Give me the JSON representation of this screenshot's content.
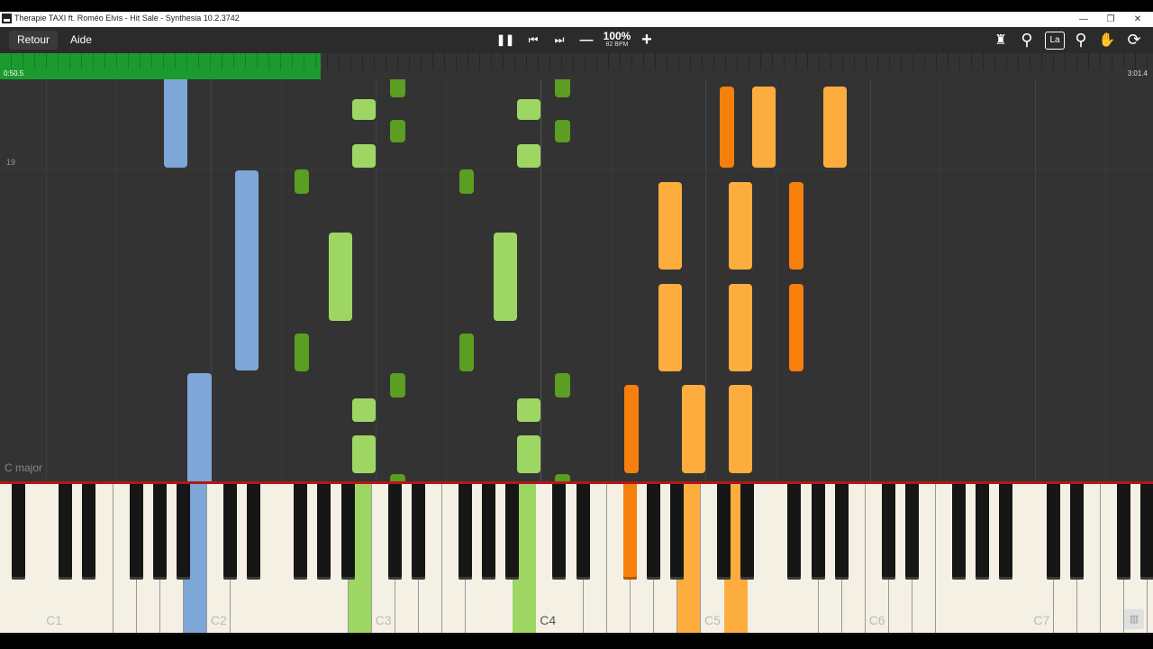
{
  "window": {
    "title": "Therapie TAXI ft. Roméo Elvis - Hit Sale - Synthesia 10.2.3742",
    "minimize": "—",
    "restore": "❐",
    "close": "✕"
  },
  "toolbar": {
    "back_label": "Retour",
    "help_label": "Aide",
    "pause_icon": "❚❚",
    "prev_icon": "⏮",
    "next_icon": "⏭",
    "minus_icon": "—",
    "plus_icon": "+",
    "speed_percent": "100%",
    "speed_bpm": "82 BPM",
    "right_icons": [
      "metronome-icon",
      "search-icon",
      "la-icon",
      "location-icon",
      "hand-icon",
      "loop-icon"
    ],
    "la_label": "La",
    "metronome_glyph": "♜",
    "search_glyph": "⚲",
    "location_glyph": "⚲",
    "hand_glyph": "✋",
    "loop_glyph": "⟳"
  },
  "progress": {
    "current": "0:50.5",
    "total": "3:01.4",
    "fraction": 0.278,
    "color": "#1b9b2f"
  },
  "roll": {
    "measure_number": "19",
    "key_signature": "C major",
    "colors": {
      "blue": "#7ea6d6",
      "light_green": "#9ed664",
      "dark_green": "#5b9e21",
      "light_orange": "#fdad3d",
      "dark_orange": "#f77f0c"
    }
  },
  "keyboard": {
    "octave_labels": [
      "C1",
      "C2",
      "C3",
      "C4",
      "C5",
      "C6",
      "C7"
    ],
    "pressed_keys": [
      "blue",
      "light-green",
      "light-green",
      "dark-orange",
      "light-orange",
      "light-orange"
    ]
  }
}
